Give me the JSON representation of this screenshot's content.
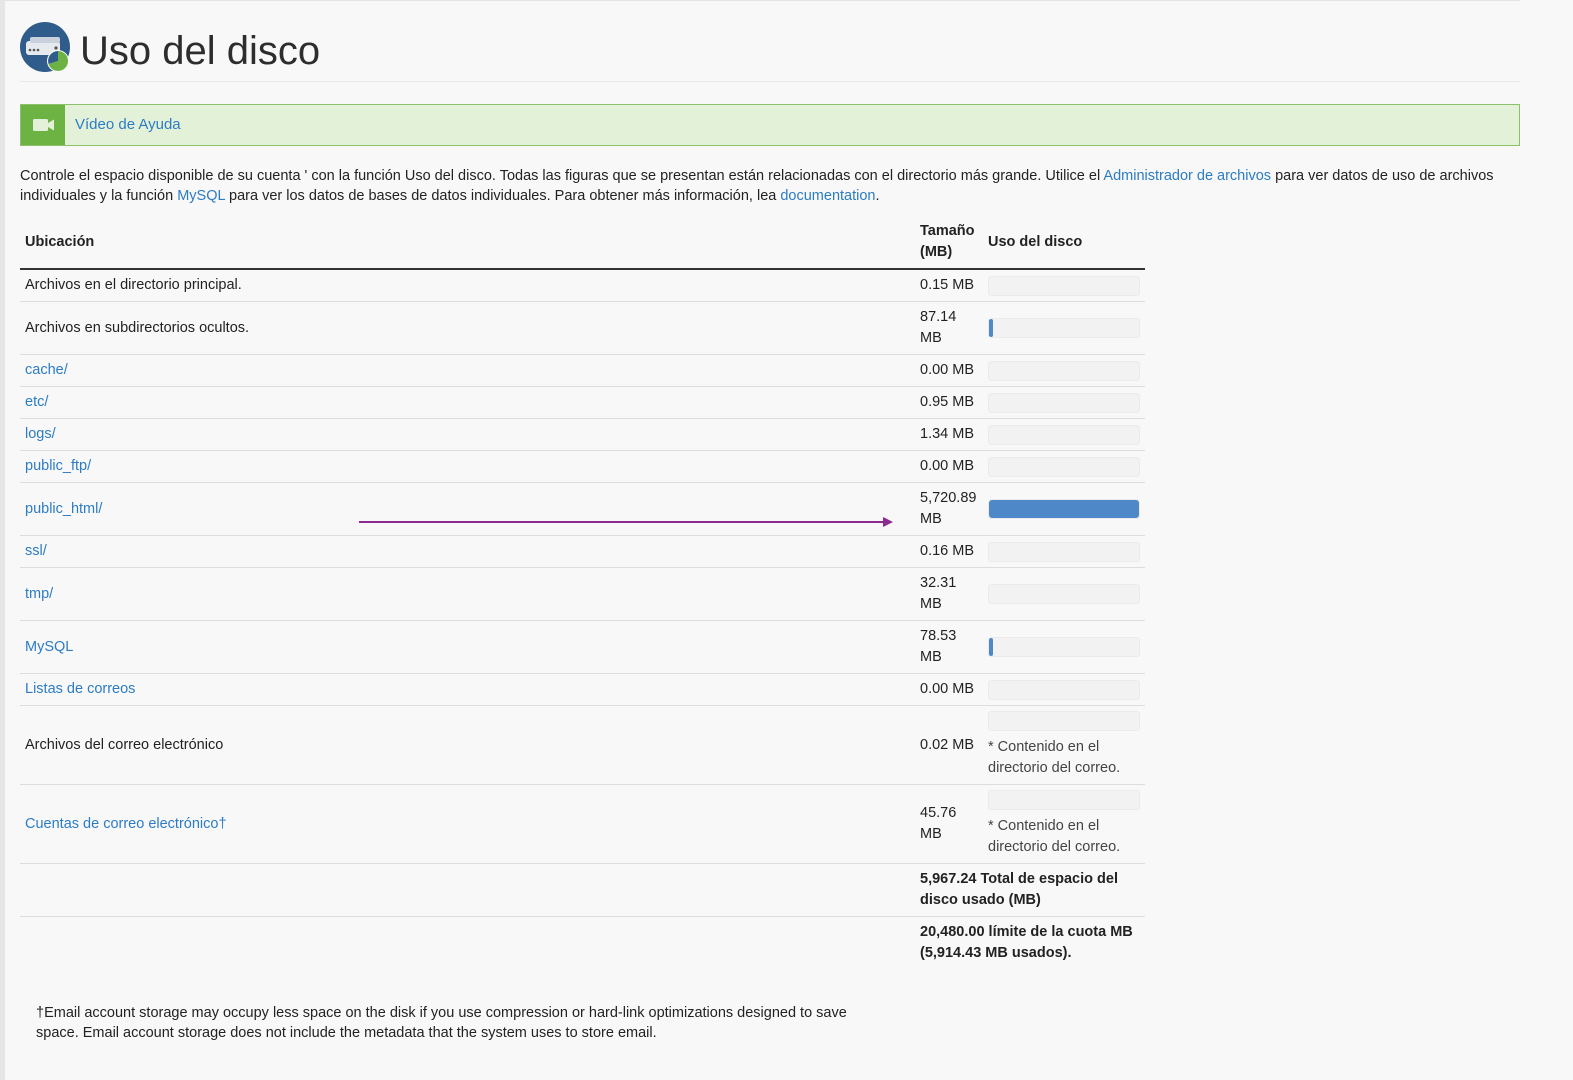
{
  "page": {
    "title": "Uso del disco"
  },
  "help": {
    "label": "Vídeo de Ayuda"
  },
  "intro": {
    "t1": "Controle el espacio disponible de su cuenta ' con la función Uso del disco. Todas las figuras que se presentan están relacionadas con el directorio más grande. Utilice el ",
    "link1": "Administrador de archivos",
    "t2": " para ver datos de uso de archivos individuales y la función ",
    "link2": "MySQL",
    "t3": " para ver los datos de bases de datos individuales. Para obtener más información, lea ",
    "link3": "documentation",
    "t4": "."
  },
  "table": {
    "headers": {
      "location": "Ubicación",
      "size": "Tamaño (MB)",
      "usage": "Uso del disco"
    },
    "rows": [
      {
        "location": "Archivos en el directorio principal.",
        "size": "0.15 MB",
        "usage": 0.0
      },
      {
        "location": "Archivos en subdirectorios ocultos.",
        "size": "87.14 MB",
        "usage": 0.0152
      },
      {
        "location": "cache/",
        "size": "0.00 MB",
        "usage": 0.0
      },
      {
        "location": "etc/",
        "size": "0.95 MB",
        "usage": 0.0
      },
      {
        "location": "logs/",
        "size": "1.34 MB",
        "usage": 0.0
      },
      {
        "location": "public_ftp/",
        "size": "0.00 MB",
        "usage": 0.0
      },
      {
        "location": "public_html/",
        "size": "5,720.89 MB",
        "usage": 1.0
      },
      {
        "location": "ssl/",
        "size": "0.16 MB",
        "usage": 0.0
      },
      {
        "location": "tmp/",
        "size": "32.31 MB",
        "usage": 0.0
      },
      {
        "location": "MySQL",
        "size": "78.53 MB",
        "usage": 0.0137
      },
      {
        "location": "Listas de correos",
        "size": "0.00 MB",
        "usage": 0.0
      },
      {
        "location": "Archivos del correo electrónico",
        "size": "0.02 MB",
        "usage": 0.0,
        "note": "* Contenido en el directorio del correo."
      },
      {
        "location": "Cuentas de correo electrónico†",
        "size": "45.76 MB",
        "usage": 0.0,
        "note": "* Contenido en el directorio del correo."
      }
    ],
    "total_line": "5,967.24 Total de espacio del disco usado (MB)",
    "quota_line": "20,480.00 límite de la cuota MB (5,914.43 MB usados)."
  },
  "footnote": "†Email account storage may occupy less space on the disk if you use compression or hard-link optimizations designed to save space. Email account storage does not include the metadata that the system uses to store email.",
  "colors": {
    "link": "#2c7cc5",
    "bar_fill": "#4f88c9",
    "help_bg": "#e3f1d8",
    "help_icon": "#6cb344",
    "arrow": "#8b2a8f"
  },
  "icons": {
    "page": "disk-usage-icon",
    "help": "video-camera-icon",
    "annotation": "arrow-icon"
  }
}
